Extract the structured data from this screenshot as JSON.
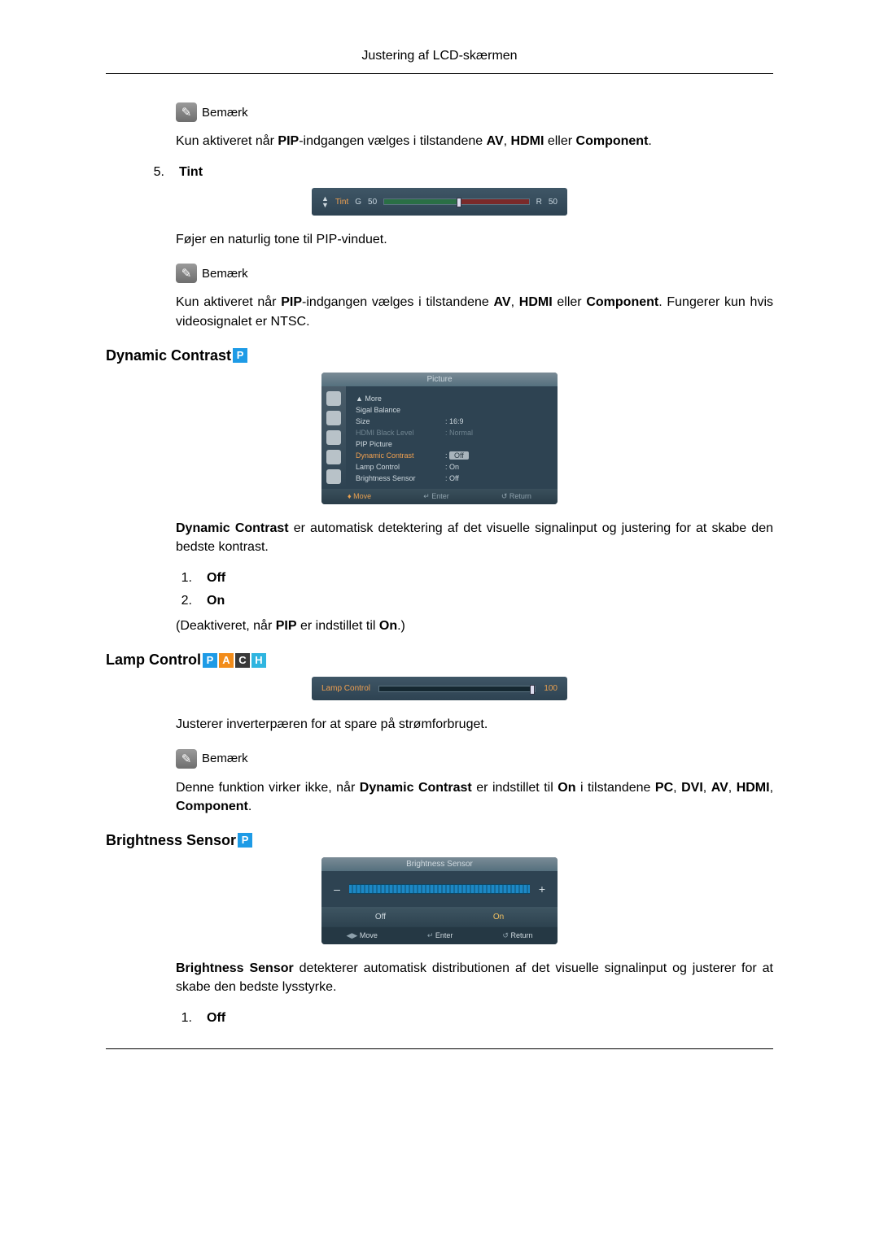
{
  "header": "Justering af LCD-skærmen",
  "note_label": "Bemærk",
  "note1_text_pre": "Kun aktiveret når ",
  "note1_b1": "PIP",
  "note1_text_mid": "-indgangen vælges i tilstandene ",
  "note1_b2": "AV",
  "note1_sep1": ", ",
  "note1_b3": "HDMI",
  "note1_sep2": " eller ",
  "note1_b4": "Component",
  "note1_end": ".",
  "item5_num": "5.",
  "item5_label": "Tint",
  "osd_tint": {
    "label": "Tint",
    "g": "G",
    "gval": "50",
    "r": "R",
    "rval": "50"
  },
  "tint_desc": "Føjer en naturlig tone til PIP-vinduet.",
  "note2_pre": "Kun aktiveret når ",
  "note2_b1": "PIP",
  "note2_mid": "-indgangen vælges i tilstandene ",
  "note2_b2": "AV",
  "note2_sep1": ", ",
  "note2_b3": "HDMI",
  "note2_sep2": " eller ",
  "note2_b4": "Component",
  "note2_tail": ". Fungerer kun hvis videosignalet er NTSC.",
  "dyn_heading": "Dynamic Contrast",
  "badge_p": "P",
  "badge_a": "A",
  "badge_c": "C",
  "badge_h": "H",
  "osd_pic": {
    "title": "Picture",
    "more": "▲ More",
    "l1k": "Sigal Balance",
    "l2k": "Size",
    "l2v": ": 16:9",
    "l3k": "HDMI Black Level",
    "l3v": ": Normal",
    "l4k": "PIP Picture",
    "l5k": "Dynamic Contrast",
    "l5v": "Off",
    "l6k": "Lamp Control",
    "l6v": ": On",
    "l7k": "Brightness Sensor",
    "l7v": ": Off",
    "f1": "Move",
    "f2": "Enter",
    "f3": "Return"
  },
  "dyn_desc_b": "Dynamic Contrast",
  "dyn_desc_tail": " er automatisk detektering af det visuelle signalinput og justering for at skabe den bedste kontrast.",
  "dyn_list": {
    "n1": "1.",
    "l1": "Off",
    "n2": "2.",
    "l2": "On"
  },
  "dyn_note_pre": "(Deaktiveret, når ",
  "dyn_note_b1": "PIP",
  "dyn_note_mid": " er indstillet til ",
  "dyn_note_b2": "On",
  "dyn_note_end": ".)",
  "lamp_heading": "Lamp Control",
  "osd_lamp": {
    "label": "Lamp Control",
    "value": "100"
  },
  "lamp_desc": "Justerer inverterpæren for at spare på strømforbruget.",
  "lamp_note_pre": "Denne funktion virker ikke, når ",
  "lamp_note_b1": "Dynamic Contrast",
  "lamp_note_mid": " er indstillet til ",
  "lamp_note_b2": "On",
  "lamp_note_mid2": " i tilstandene ",
  "lamp_note_b3": "PC",
  "lamp_note_sep1": ", ",
  "lamp_note_b4": "DVI",
  "lamp_note_sep2": ", ",
  "lamp_note_b5": "AV",
  "lamp_note_sep3": ", ",
  "lamp_note_b6": "HDMI",
  "lamp_note_sep4": ", ",
  "lamp_note_b7": "Component",
  "lamp_note_end": ".",
  "bs_heading": "Brightness Sensor ",
  "osd_bs": {
    "title": "Brightness Sensor",
    "minus": "–",
    "plus": "+",
    "off": "Off",
    "on": "On",
    "f1": "Move",
    "f2": "Enter",
    "f3": "Return"
  },
  "bs_desc_b": "Brightness Sensor",
  "bs_desc_tail": " detekterer automatisk distributionen af det visuelle signalinput og justerer for at skabe den bedste lysstyrke.",
  "bs_list": {
    "n1": "1.",
    "l1": "Off"
  }
}
